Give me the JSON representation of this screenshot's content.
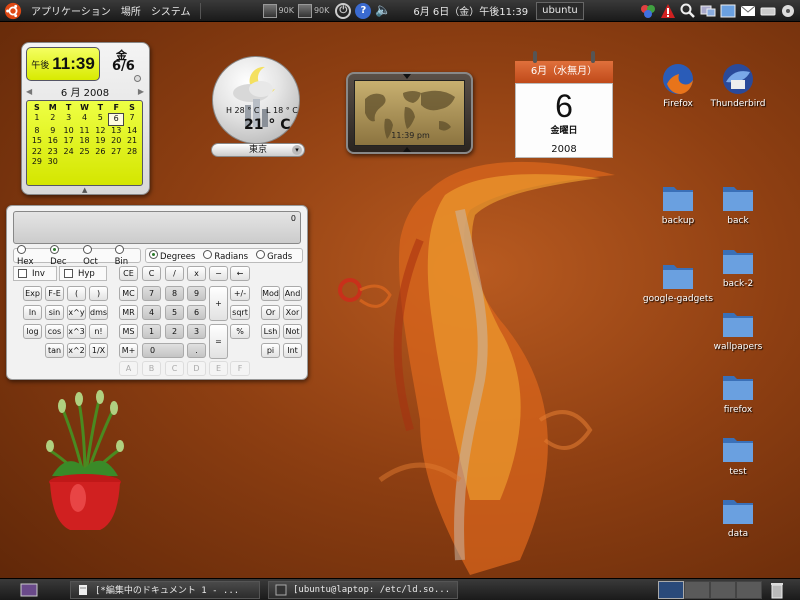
{
  "top_panel": {
    "menus": [
      "アプリケーション",
      "場所",
      "システム"
    ],
    "chip1": "90K",
    "chip2": "90K",
    "help_icon": "?",
    "clock": "6月 6日（金）午後11:39",
    "username": "ubuntu"
  },
  "calendar_gadget": {
    "ampm": "午後",
    "time": "11:39",
    "weekday": "金",
    "date": "6/6",
    "month_label": "6 月  2008",
    "prev_arrow": "◀",
    "next_arrow": "▶",
    "day_headers": [
      "S",
      "M",
      "T",
      "W",
      "T",
      "F",
      "S"
    ],
    "days": [
      "1",
      "2",
      "3",
      "4",
      "5",
      "6",
      "7",
      "8",
      "9",
      "10",
      "11",
      "12",
      "13",
      "14",
      "15",
      "16",
      "17",
      "18",
      "19",
      "20",
      "21",
      "22",
      "23",
      "24",
      "25",
      "26",
      "27",
      "28",
      "29",
      "30"
    ],
    "today": "6",
    "first_weekday_offset": 0
  },
  "weather": {
    "high": "H 28 ° C",
    "low": "L 18 ° C",
    "temp": "21 ° C",
    "city": "東京"
  },
  "world_clock": {
    "time": "11:39 pm"
  },
  "tear_calendar": {
    "month": "6月（水無月）",
    "day": "6",
    "weekday": "金曜日",
    "year": "2008"
  },
  "desktop_icons": [
    {
      "label": "Firefox",
      "type": "firefox"
    },
    {
      "label": "Thunderbird",
      "type": "thunderbird"
    },
    {
      "label": "backup",
      "type": "folder"
    },
    {
      "label": "back",
      "type": "folder"
    },
    {
      "label": "google-gadgets",
      "type": "folder"
    },
    {
      "label": "back-2",
      "type": "folder"
    },
    {
      "label": "wallpapers",
      "type": "folder"
    },
    {
      "label": "firefox",
      "type": "folder"
    },
    {
      "label": "test",
      "type": "folder"
    },
    {
      "label": "data",
      "type": "folder"
    }
  ],
  "calculator": {
    "display": "0",
    "base_modes": [
      "Hex",
      "Dec",
      "Oct",
      "Bin"
    ],
    "base_selected": "Dec",
    "angle_modes": [
      "Degrees",
      "Radians",
      "Grads"
    ],
    "angle_selected": "Degrees",
    "inv": "Inv",
    "hyp": "Hyp",
    "buttons": {
      "ce": "CE",
      "c": "C",
      "div": "/",
      "mul": "x",
      "minus": "−",
      "backspace": "←",
      "exp": "Exp",
      "fe": "F-E",
      "lparen": "(",
      "rparen": ")",
      "mc": "MC",
      "n7": "7",
      "n8": "8",
      "n9": "9",
      "plus": "+",
      "plusminus": "+/-",
      "mod": "Mod",
      "and": "And",
      "ln": "ln",
      "sin": "sin",
      "xy": "x^y",
      "dms": "dms",
      "mr": "MR",
      "n4": "4",
      "n5": "5",
      "n6": "6",
      "sqrt": "sqrt",
      "or": "Or",
      "xor": "Xor",
      "log": "log",
      "cos": "cos",
      "x3": "x^3",
      "fact": "n!",
      "ms": "MS",
      "n1": "1",
      "n2": "2",
      "n3": "3",
      "eq": "=",
      "pct": "%",
      "lsh": "Lsh",
      "not": "Not",
      "tan": "tan",
      "x2": "x^2",
      "inv1x": "1/X",
      "mplus": "M+",
      "n0": "0",
      "dot": ".",
      "pi": "pi",
      "int": "Int",
      "a": "A",
      "b": "B",
      "cc": "C",
      "d": "D",
      "e": "E",
      "f": "F"
    }
  },
  "taskbar": {
    "tasks": [
      "[*編集中のドキュメント 1 - ...",
      "[ubuntu@laptop: /etc/ld.so..."
    ]
  },
  "colors": {
    "desktop_bg": "#8e3f12",
    "gadget_yellow": "#e4f200",
    "panel": "#2a2a2a",
    "folder_blue": "#5b8fd0"
  }
}
